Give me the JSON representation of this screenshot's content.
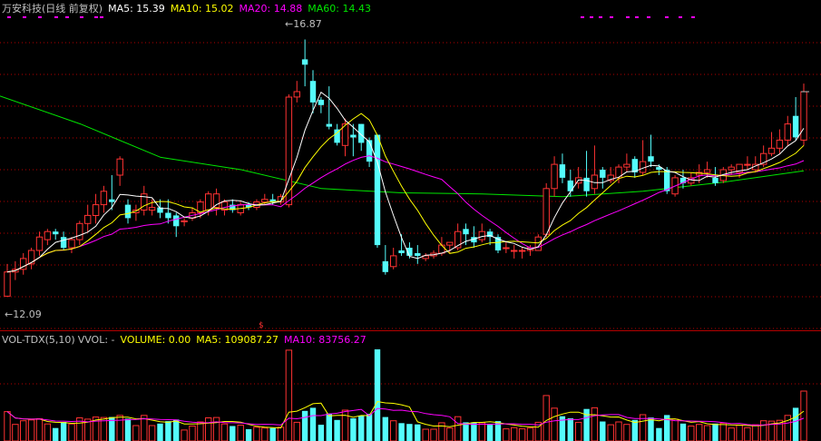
{
  "price_header": {
    "title": "万安科技(日线 前复权)",
    "ma5": "MA5: 15.39",
    "ma10": "MA10: 15.02",
    "ma20": "MA20: 14.88",
    "ma60": "MA60: 14.43"
  },
  "volume_header": {
    "indicator": "VOL-TDX(5,10)",
    "vvol": "VVOL: -",
    "volume": "VOLUME: 0.00",
    "ma5": "MA5: 109087.27",
    "ma10": "MA10: 83756.27"
  },
  "annotations": {
    "high_label": "16.87",
    "low_label": "12.09"
  },
  "colors": {
    "up": "#ff3232",
    "down": "#54fcfc",
    "ma5": "#ffffff",
    "ma10": "#ffff00",
    "ma20": "#ff00ff",
    "ma60": "#00e600",
    "grid": "#b40000",
    "text": "#c0c0c0"
  },
  "chart_data": [
    {
      "type": "candlestick",
      "ylim": [
        11.5,
        17.3
      ],
      "high": 16.87,
      "low": 12.09,
      "candles": [
        [
          12.1,
          12.55,
          12.7,
          12.09
        ],
        [
          12.55,
          12.6,
          12.75,
          12.4
        ],
        [
          12.6,
          12.8,
          12.9,
          12.5
        ],
        [
          12.7,
          12.95,
          13.0,
          12.6
        ],
        [
          12.95,
          13.2,
          13.3,
          12.85
        ],
        [
          13.15,
          13.3,
          13.35,
          13.05
        ],
        [
          13.3,
          13.25,
          13.35,
          13.15
        ],
        [
          13.2,
          13.0,
          13.3,
          12.95
        ],
        [
          13.0,
          13.15,
          13.2,
          12.9
        ],
        [
          13.15,
          13.45,
          13.5,
          13.05
        ],
        [
          13.45,
          13.6,
          13.8,
          13.3
        ],
        [
          13.6,
          13.8,
          14.0,
          13.45
        ],
        [
          13.8,
          14.05,
          14.15,
          13.65
        ],
        [
          13.9,
          13.85,
          14.35,
          13.7
        ],
        [
          14.35,
          14.65,
          14.7,
          14.15
        ],
        [
          13.8,
          13.55,
          13.9,
          13.45
        ],
        [
          13.65,
          13.7,
          13.8,
          13.5
        ],
        [
          13.7,
          14.0,
          14.15,
          13.6
        ],
        [
          13.7,
          13.75,
          13.9,
          13.6
        ],
        [
          13.75,
          13.65,
          13.9,
          13.55
        ],
        [
          13.65,
          13.55,
          13.9,
          13.45
        ],
        [
          13.6,
          13.4,
          13.65,
          13.2
        ],
        [
          13.5,
          13.5,
          13.55,
          13.4
        ],
        [
          13.55,
          13.65,
          13.75,
          13.5
        ],
        [
          13.65,
          13.85,
          13.9,
          13.55
        ],
        [
          13.7,
          14.0,
          14.05,
          13.6
        ],
        [
          13.75,
          14.0,
          14.1,
          13.6
        ],
        [
          13.7,
          13.85,
          13.9,
          13.6
        ],
        [
          13.8,
          13.7,
          13.9,
          13.65
        ],
        [
          13.65,
          13.8,
          13.85,
          13.6
        ],
        [
          13.8,
          13.75,
          13.85,
          13.7
        ],
        [
          13.75,
          13.85,
          13.9,
          13.7
        ],
        [
          13.85,
          13.9,
          14.0,
          13.8
        ],
        [
          13.9,
          13.85,
          14.0,
          13.8
        ],
        [
          13.85,
          13.95,
          14.0,
          13.8
        ],
        [
          13.8,
          15.8,
          15.85,
          13.75
        ],
        [
          15.8,
          15.9,
          16.1,
          15.7
        ],
        [
          16.5,
          16.4,
          16.87,
          16.0
        ],
        [
          16.1,
          15.7,
          16.3,
          15.5
        ],
        [
          15.75,
          15.65,
          15.8,
          15.5
        ],
        [
          15.3,
          15.25,
          16.0,
          15.2
        ],
        [
          15.2,
          14.95,
          15.3,
          14.9
        ],
        [
          14.9,
          15.3,
          15.4,
          14.7
        ],
        [
          15.1,
          15.05,
          15.3,
          14.7
        ],
        [
          15.3,
          14.95,
          15.3,
          14.8
        ],
        [
          15.0,
          14.6,
          15.05,
          14.5
        ],
        [
          15.1,
          13.05,
          15.1,
          13.0
        ],
        [
          12.75,
          12.55,
          13.05,
          12.5
        ],
        [
          12.65,
          12.85,
          13.0,
          12.6
        ],
        [
          12.95,
          12.9,
          13.25,
          12.85
        ],
        [
          13.0,
          12.85,
          13.1,
          12.8
        ],
        [
          12.9,
          12.85,
          13.05,
          12.7
        ],
        [
          12.8,
          12.85,
          12.9,
          12.75
        ],
        [
          12.85,
          12.9,
          12.95,
          12.8
        ],
        [
          12.9,
          13.05,
          13.2,
          12.85
        ],
        [
          13.05,
          13.1,
          13.1,
          12.9
        ],
        [
          13.0,
          13.3,
          13.45,
          12.95
        ],
        [
          13.35,
          13.25,
          13.45,
          13.05
        ],
        [
          13.2,
          13.1,
          13.4,
          13.0
        ],
        [
          13.15,
          13.3,
          13.45,
          13.1
        ],
        [
          13.3,
          13.2,
          13.35,
          13.05
        ],
        [
          13.2,
          12.95,
          13.25,
          12.9
        ],
        [
          13.0,
          13.0,
          13.1,
          12.9
        ],
        [
          12.95,
          12.95,
          13.05,
          12.8
        ],
        [
          12.95,
          12.95,
          13.0,
          12.8
        ],
        [
          12.95,
          13.0,
          13.05,
          12.85
        ],
        [
          12.95,
          13.2,
          13.25,
          12.95
        ],
        [
          13.25,
          14.1,
          14.2,
          13.2
        ],
        [
          14.1,
          14.55,
          14.7,
          13.95
        ],
        [
          14.55,
          14.3,
          14.75,
          14.2
        ],
        [
          14.25,
          14.05,
          14.45,
          13.95
        ],
        [
          14.2,
          14.3,
          14.5,
          14.1
        ],
        [
          14.3,
          14.05,
          14.8,
          13.95
        ],
        [
          14.1,
          14.35,
          14.9,
          14.0
        ],
        [
          14.45,
          14.3,
          14.5,
          14.1
        ],
        [
          14.25,
          14.35,
          14.5,
          14.2
        ],
        [
          14.3,
          14.5,
          14.55,
          14.2
        ],
        [
          14.5,
          14.55,
          14.75,
          14.4
        ],
        [
          14.65,
          14.4,
          14.7,
          14.3
        ],
        [
          14.4,
          14.6,
          15.0,
          14.35
        ],
        [
          14.7,
          14.6,
          15.1,
          14.5
        ],
        [
          14.5,
          14.45,
          14.55,
          14.35
        ],
        [
          14.45,
          14.05,
          14.5,
          14.0
        ],
        [
          14.0,
          14.3,
          14.35,
          13.95
        ],
        [
          14.3,
          14.2,
          14.45,
          14.1
        ],
        [
          14.2,
          14.3,
          14.4,
          14.15
        ],
        [
          14.35,
          14.4,
          14.55,
          14.2
        ],
        [
          14.4,
          14.45,
          14.6,
          14.3
        ],
        [
          14.3,
          14.2,
          14.5,
          14.15
        ],
        [
          14.25,
          14.45,
          14.5,
          14.2
        ],
        [
          14.45,
          14.5,
          14.55,
          14.35
        ],
        [
          14.4,
          14.55,
          14.55,
          14.3
        ],
        [
          14.55,
          14.55,
          14.7,
          14.45
        ],
        [
          14.45,
          14.55,
          14.7,
          14.4
        ],
        [
          14.55,
          14.75,
          14.9,
          14.5
        ],
        [
          14.75,
          14.85,
          15.15,
          14.7
        ],
        [
          14.85,
          15.0,
          15.2,
          14.75
        ],
        [
          15.0,
          15.3,
          15.45,
          14.9
        ],
        [
          15.45,
          15.05,
          15.8,
          15.0
        ],
        [
          15.0,
          15.9,
          16.05,
          14.9
        ]
      ],
      "ma60": [
        15.82,
        15.3,
        14.68,
        14.45,
        14.1,
        14.02,
        14.0,
        13.95,
        14.05,
        14.22,
        14.43
      ]
    },
    {
      "type": "bar",
      "series": [
        {
          "name": "VOLUME",
          "values": []
        }
      ]
    }
  ]
}
